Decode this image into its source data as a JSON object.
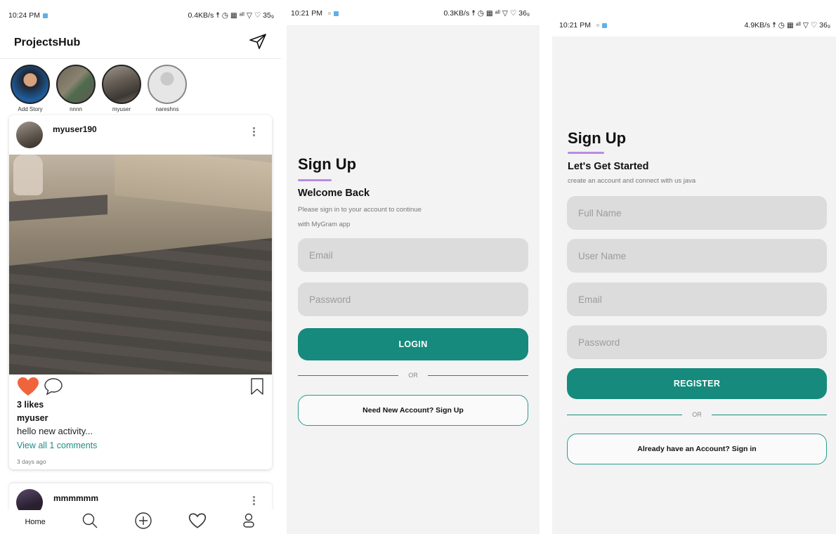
{
  "screen1": {
    "status": {
      "time": "10:24 PM",
      "right": "0.4KB/s ☨ ◷ ▦ ᵃˡˡ ▽ ♡ 35₉"
    },
    "app_title": "ProjectsHub",
    "stories": [
      {
        "label": "Add Story"
      },
      {
        "label": "nnnn"
      },
      {
        "label": "myuser"
      },
      {
        "label": "nareshns"
      }
    ],
    "post": {
      "username": "myuser190",
      "likes": "3 likes",
      "caption_user": "myuser",
      "caption": "hello new activity...",
      "view_comments": "View all 1 comments",
      "time_ago": "3 days ago"
    },
    "next_post": {
      "username": "mmmmmm"
    },
    "nav": {
      "home": "Home"
    }
  },
  "screen2": {
    "status": {
      "time": "10:21 PM",
      "right": "0.3KB/s ☨ ◷ ▦ ᵃˡˡ ▽ ♡ 36₉"
    },
    "title": "Sign Up",
    "subtitle": "Welcome Back",
    "desc_line1": "Please sign in to your account to continue",
    "desc_line2": "with MyGram app",
    "email_placeholder": "Email",
    "password_placeholder": "Password",
    "login_label": "LOGIN",
    "or": "OR",
    "signup_link": "Need New Account? Sign Up"
  },
  "screen3": {
    "status": {
      "time": "10:21 PM",
      "right": "4.9KB/s ☨ ◷ ▦ ᵃˡˡ ▽ ♡ 36₉"
    },
    "title": "Sign Up",
    "subtitle": "Let's Get Started",
    "desc": "create an account and connect with us java",
    "fullname_placeholder": "Full Name",
    "username_placeholder": "User Name",
    "email_placeholder": "Email",
    "password_placeholder": "Password",
    "register_label": "REGISTER",
    "or": "OR",
    "signin_link": "Already have an Account? Sign in"
  },
  "colors": {
    "accent": "#168a7c",
    "heading_underline": "#b78be2",
    "heart": "#f0643c",
    "link": "#1f8c86"
  },
  "icons": [
    "send-icon",
    "kebab-icon",
    "heart-icon",
    "comment-icon",
    "bookmark-icon",
    "search-icon",
    "add-icon",
    "favorite-icon",
    "profile-icon"
  ]
}
